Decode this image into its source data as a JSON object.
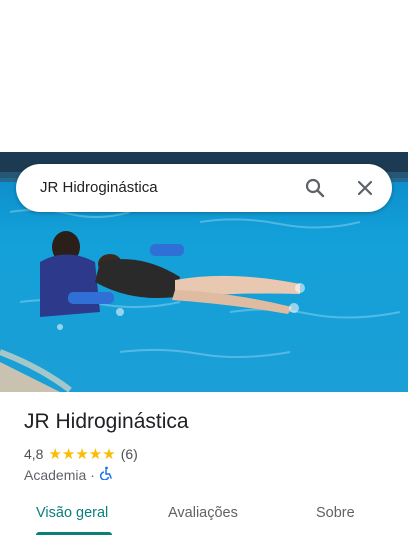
{
  "search": {
    "query": "JR Hidroginástica"
  },
  "place": {
    "name": "JR Hidroginástica",
    "rating": "4,8",
    "stars": "★★★★★",
    "review_count": "(6)",
    "category": "Academia",
    "separator": "·"
  },
  "icons": [
    "search-icon",
    "close-icon",
    "wheelchair-icon"
  ],
  "colors": {
    "accent": "#0b7f7a",
    "stars": "#fbbc04",
    "water": "#1aa3d9"
  },
  "tabs": [
    {
      "label": "Visão geral",
      "active": true
    },
    {
      "label": "Avaliações",
      "active": false
    },
    {
      "label": "Sobre",
      "active": false
    }
  ]
}
